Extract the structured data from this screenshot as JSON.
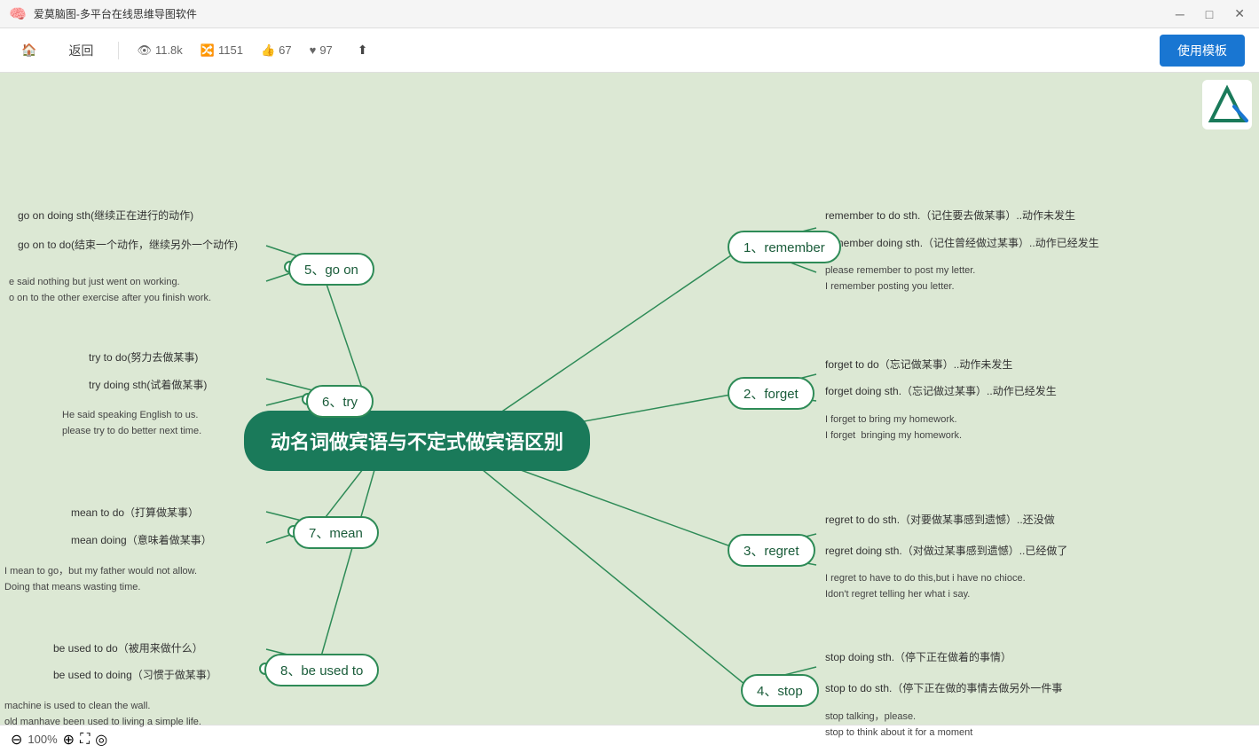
{
  "titlebar": {
    "title": "爱莫脑图-多平台在线思维导图软件",
    "min_btn": "─",
    "max_btn": "□",
    "close_btn": "✕"
  },
  "toolbar": {
    "home_label": "主页",
    "back_label": "返回",
    "views_icon": "👁",
    "views_count": "11.8k",
    "forks_icon": "🔀",
    "forks_count": "1151",
    "likes_icon": "👍",
    "likes_count": "67",
    "favorites_icon": "♥",
    "favorites_count": "97",
    "share_icon": "⬆",
    "use_template_label": "使用模板"
  },
  "mindmap": {
    "center_title": "动名词做宾语与不定式做宾语区别",
    "left_branches": [
      {
        "id": "go_on",
        "label": "5、go on",
        "items": [
          "go on doing sth(继续正在进行的动作)",
          "go on to do(结束一个动作，继续另外一个动作)"
        ],
        "example": "e said nothing but just went on working.\no on to the other exercise after you finish work."
      },
      {
        "id": "try",
        "label": "6、try",
        "items": [
          "try to do(努力去做某事)",
          "try doing sth(试着做某事)"
        ],
        "example": "He said speaking English to us.\nplease try to do better next time."
      },
      {
        "id": "mean",
        "label": "7、mean",
        "items": [
          "mean to do（打算做某事）",
          "mean doing（意味着做某事）"
        ],
        "example": "I mean to go，but my father would not allow.\nDoing that means wasting time."
      },
      {
        "id": "be_used_to",
        "label": "8、be used to",
        "items": [
          "be used to do（被用来做什么）",
          "be used to doing（习惯于做某事）"
        ],
        "example": "machine is used to clean the wall.\nold manhave been used to living a simple life."
      }
    ],
    "right_branches": [
      {
        "id": "remember",
        "label": "1、remember",
        "items": [
          "remember to do sth.（记住要去做某事）..动作未发生",
          "remember doing sth.（记住曾经做过某事）..动作已经发生"
        ],
        "example": "please remember to post my letter.\nI remember posting you letter."
      },
      {
        "id": "forget",
        "label": "2、forget",
        "items": [
          "forget to do（忘记做某事）..动作未发生",
          "forget doing sth.（忘记做过某事）..动作已经发生"
        ],
        "example": "I forget to bring my homework.\nI forget  bringing my homework."
      },
      {
        "id": "regret",
        "label": "3、regret",
        "items": [
          "regret to do sth.（对要做某事感到遗憾）..还没做",
          "regret doing sth.（对做过某事感到遗憾）..已经做了"
        ],
        "example": "I regret to have to do this,but i have no chioce.\nIdon't regret telling her what i say."
      },
      {
        "id": "stop",
        "label": "4、stop",
        "items": [
          "stop doing sth.（停下正在做着的事情）",
          "stop to do sth.（停下正在做的事情去做另外一件事"
        ],
        "example": "stop talking，please.\nstop to think about it for a moment"
      }
    ]
  },
  "bottombar": {
    "zoom_out_icon": "⊖",
    "zoom_level": "100%",
    "zoom_in_icon": "⊕",
    "fullscreen_icon": "⛶",
    "eye_icon": "◎"
  }
}
